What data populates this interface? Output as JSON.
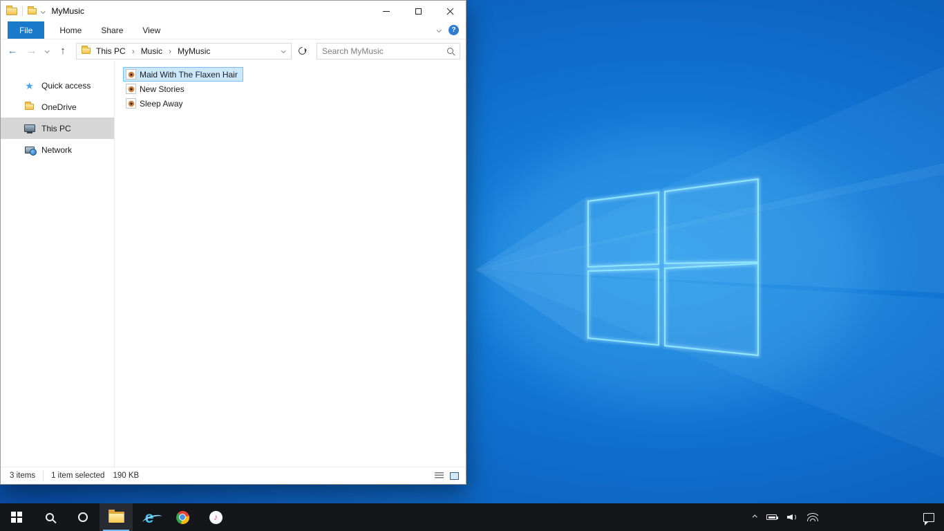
{
  "window": {
    "title": "MyMusic"
  },
  "ribbon": {
    "tabs": [
      "File",
      "Home",
      "Share",
      "View"
    ]
  },
  "address": {
    "crumbs": [
      "This PC",
      "Music",
      "MyMusic"
    ],
    "separator": "›",
    "search_placeholder": "Search MyMusic"
  },
  "sidebar": {
    "items": [
      {
        "label": "Quick access",
        "icon": "star"
      },
      {
        "label": "OneDrive",
        "icon": "folder"
      },
      {
        "label": "This PC",
        "icon": "computer",
        "selected": true
      },
      {
        "label": "Network",
        "icon": "network"
      }
    ]
  },
  "files": [
    {
      "name": "Maid With The Flaxen Hair",
      "selected": true
    },
    {
      "name": "New Stories",
      "selected": false
    },
    {
      "name": "Sleep Away",
      "selected": false
    }
  ],
  "status": {
    "count": "3 items",
    "selected": "1 item selected",
    "size": "190 KB"
  },
  "icons": {
    "back_arrow": "←",
    "forward_arrow": "→",
    "up_arrow": "↑",
    "star": "★",
    "music_note": "♪",
    "help": "?",
    "ie_letter": "e"
  },
  "taskbar": {
    "buttons": [
      "start",
      "search",
      "cortana",
      "file-explorer",
      "internet-explorer",
      "chrome",
      "itunes"
    ],
    "active_button": "file-explorer",
    "tray": [
      "hidden-icons",
      "battery",
      "volume",
      "network",
      "action-center"
    ]
  },
  "colors": {
    "accent": "#1979ca",
    "selection_bg": "#cce8ff",
    "selection_border": "#77c0f5",
    "nav_selected_bg": "#d6d6d6",
    "taskbar_bg": "#14161a",
    "wallpaper_blue": "#0f6fce"
  }
}
